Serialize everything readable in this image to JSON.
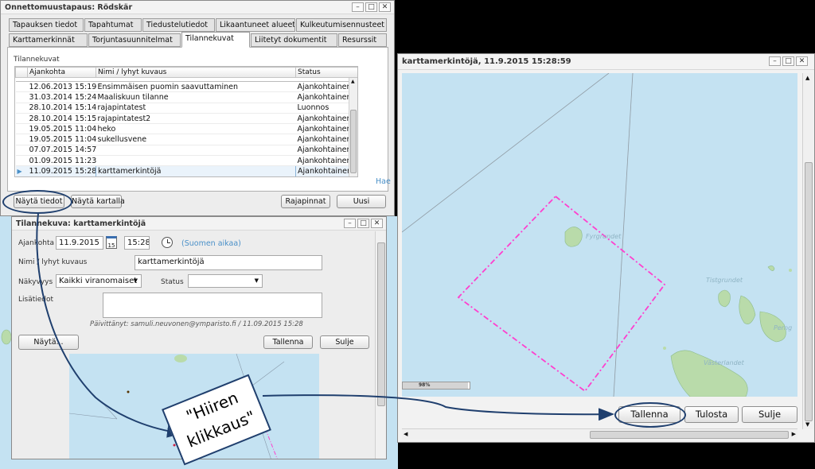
{
  "incident_window": {
    "title": "Onnettomuustapaus: Rödskär",
    "tabs_row1": [
      "Tapauksen tiedot",
      "Tapahtumat",
      "Tiedustelutiedot",
      "Likaantuneet alueet",
      "Kulkeutumisennusteet"
    ],
    "tabs_row2": [
      "Karttamerkinnät",
      "Torjuntasuunnitelmat",
      "Tilannekuvat",
      "Liitetyt dokumentit",
      "Resurssit"
    ],
    "active_tab": "Tilannekuvat",
    "section_label": "Tilannekuvat",
    "columns": [
      "Ajankohta",
      "Nimi / lyhyt kuvaus",
      "Status"
    ],
    "rows": [
      {
        "time": "12.06.2013 15:19",
        "name": "Ensimmäisen puomin saavuttaminen",
        "status": "Ajankohtainen"
      },
      {
        "time": "31.03.2014 15:24",
        "name": "Maaliskuun tilanne",
        "status": "Ajankohtainen"
      },
      {
        "time": "28.10.2014 15:14",
        "name": "rajapintatest",
        "status": "Luonnos"
      },
      {
        "time": "28.10.2014 15:15",
        "name": "rajapintatest2",
        "status": "Ajankohtainen"
      },
      {
        "time": "19.05.2015 11:04",
        "name": "heko",
        "status": "Ajankohtainen"
      },
      {
        "time": "19.05.2015 11:04",
        "name": "sukellusvene",
        "status": "Ajankohtainen"
      },
      {
        "time": "07.07.2015 14:57",
        "name": "",
        "status": "Ajankohtainen"
      },
      {
        "time": "01.09.2015 11:23",
        "name": "",
        "status": "Ajankohtainen"
      },
      {
        "time": "11.09.2015 15:28",
        "name": "karttamerkintöjä",
        "status": "Ajankohtainen"
      }
    ],
    "search_link": "Hae",
    "buttons": {
      "show_details": "Näytä tiedot",
      "show_on_map": "Näytä kartalla",
      "interfaces": "Rajapinnat",
      "new": "Uusi"
    }
  },
  "situation_window": {
    "title": "Tilannekuva: karttamerkintöjä",
    "labels": {
      "time": "Ajankohta",
      "name": "Nimi / lyhyt kuvaus",
      "visibility": "Näkyvyys",
      "status": "Status",
      "extra": "Lisätiedot"
    },
    "date_value": "11.9.2015",
    "calendar_day": "15",
    "time_value": "15:28",
    "timezone": "(Suomen aikaa)",
    "name_value": "karttamerkintöjä",
    "visibility_value": "Kaikki viranomaiset",
    "status_value": "",
    "updated_text": "Päivittänyt: samuli.neuvonen@ymparisto.fi / 11.09.2015 15:28",
    "buttons": {
      "show": "Näytä...",
      "save": "Tallenna",
      "close": "Sulje"
    }
  },
  "map_window": {
    "title": "karttamerkintöjä, 11.9.2015 15:28:59",
    "place_labels": [
      "Fyrgrundet",
      "Tistgrundet",
      "Västerlandet",
      "Perng"
    ],
    "progress_text": "98%",
    "progress_value": 0.98,
    "buttons": {
      "save": "Tallenna",
      "print": "Tulosta",
      "close": "Sulje"
    }
  },
  "annotation": {
    "callout_text": "\"Hiiren klikkaus\""
  },
  "colors": {
    "map_water": "#c4e2f2",
    "land": "#b9dbaa",
    "polygon": "#ff3fce",
    "annotation": "#1f3f6e"
  }
}
